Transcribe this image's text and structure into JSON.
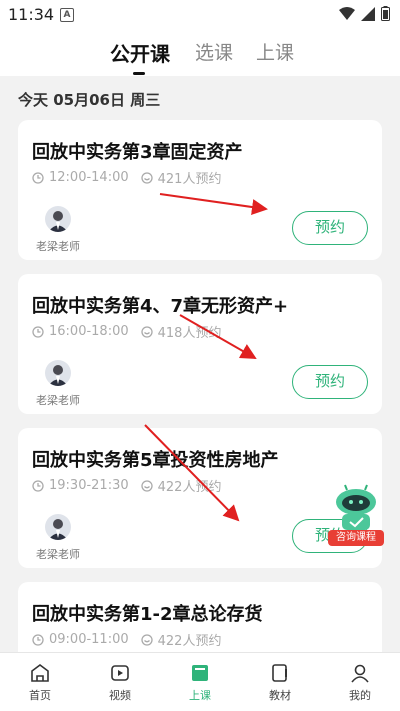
{
  "status_bar": {
    "time": "11:34",
    "a_badge": "A"
  },
  "top_tabs": [
    {
      "label": "公开课",
      "active": true
    },
    {
      "label": "选课",
      "active": false
    },
    {
      "label": "上课",
      "active": false
    }
  ],
  "date_header": "今天 05月06日 周三",
  "courses": [
    {
      "title": "回放中实务第3章固定资产",
      "time": "12:00-14:00",
      "booked": "421人预约",
      "teacher": "老梁老师",
      "button": "预约"
    },
    {
      "title": "回放中实务第4、7章无形资产+",
      "time": "16:00-18:00",
      "booked": "418人预约",
      "teacher": "老梁老师",
      "button": "预约"
    },
    {
      "title": "回放中实务第5章投资性房地产",
      "time": "19:30-21:30",
      "booked": "422人预约",
      "teacher": "老梁老师",
      "button": "预约"
    },
    {
      "title": "回放中实务第1-2章总论存货",
      "time": "09:00-11:00",
      "booked": "422人预约",
      "teacher": "",
      "button": ""
    }
  ],
  "consult_label": "咨询课程",
  "bottom_nav": [
    {
      "label": "首页",
      "icon": "home-icon",
      "active": false
    },
    {
      "label": "视频",
      "icon": "video-icon",
      "active": false
    },
    {
      "label": "上课",
      "icon": "class-icon",
      "active": true
    },
    {
      "label": "教材",
      "icon": "book-icon",
      "active": false
    },
    {
      "label": "我的",
      "icon": "profile-icon",
      "active": false
    }
  ],
  "colors": {
    "accent": "#2fb37a",
    "arrow": "#e02020",
    "consult_badge": "#e83e35"
  }
}
